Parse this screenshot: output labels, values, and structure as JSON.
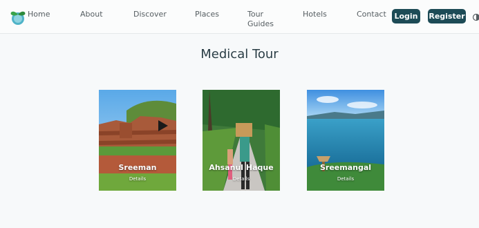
{
  "nav": {
    "links": [
      "Home",
      "About",
      "Discover",
      "Places",
      "Tour Guides",
      "Hotels",
      "Contact"
    ],
    "login_label": "Login",
    "register_label": "Register",
    "logo_icon": "leaf-globe-logo",
    "theme_icon": "theme-toggle-icon"
  },
  "main": {
    "title": "Medical Tour",
    "cards": [
      {
        "title": "Sreeman",
        "details_label": "Details",
        "image": "brick-ruins-photo"
      },
      {
        "title": "Ahsanul Haque",
        "details_label": "Details",
        "image": "village-road-photo"
      },
      {
        "title": "Sreemangal",
        "details_label": "Details",
        "image": "lake-photo"
      }
    ]
  },
  "colors": {
    "button_bg": "#1d4b56",
    "title_text": "#2a3d45",
    "nav_text": "#555d61"
  }
}
